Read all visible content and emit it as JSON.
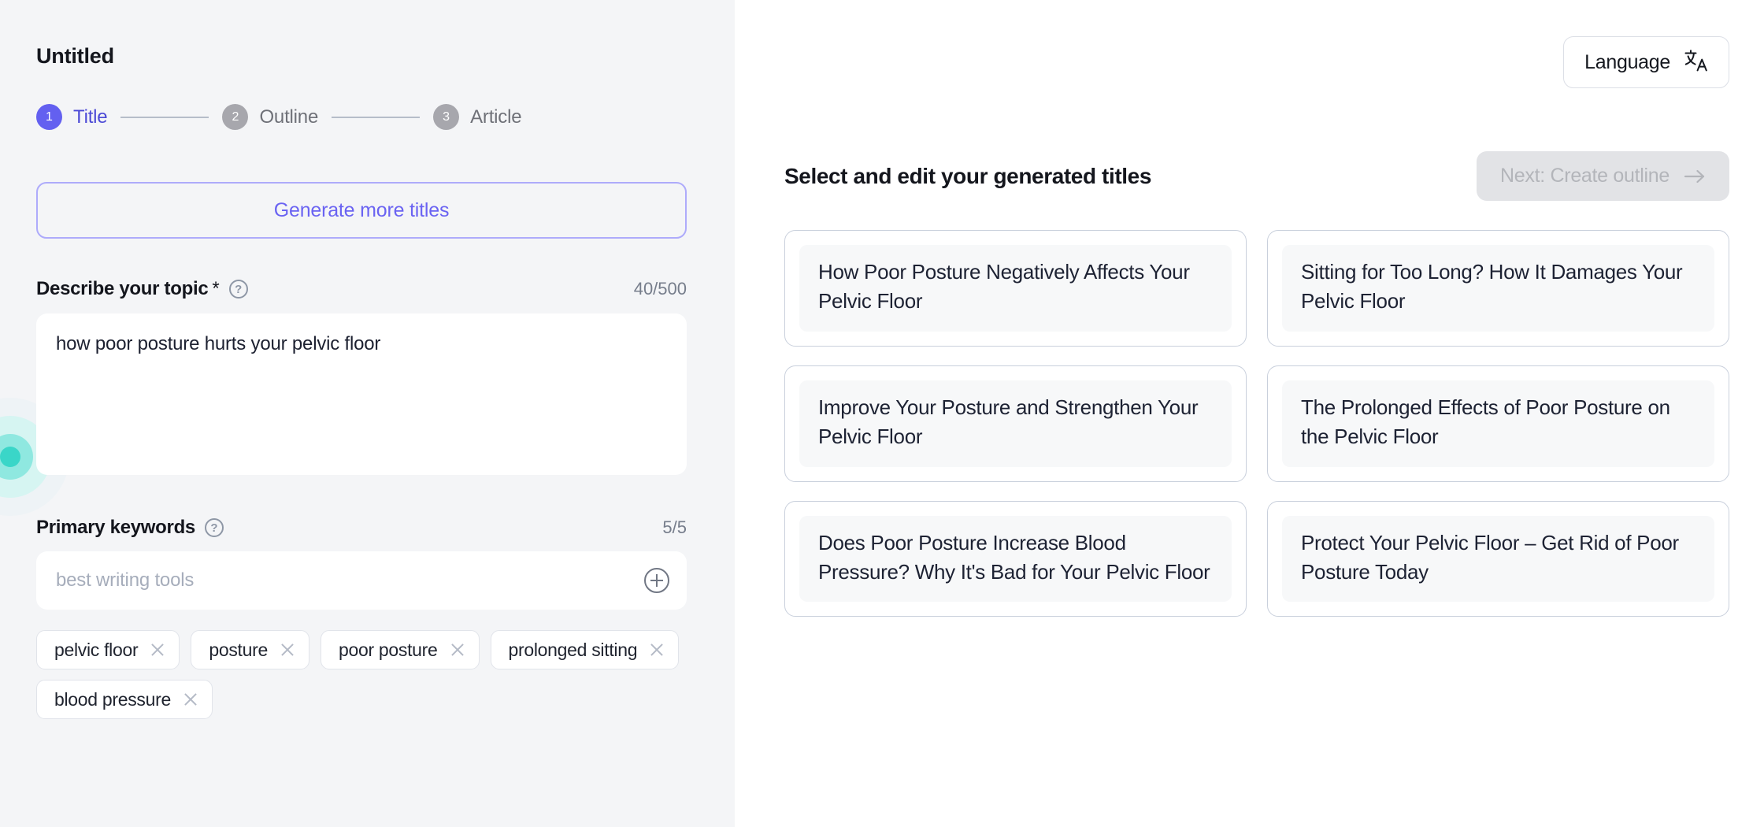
{
  "sidebar": {
    "doc_title": "Untitled",
    "steps": [
      {
        "number": "1",
        "label": "Title",
        "state": "active"
      },
      {
        "number": "2",
        "label": "Outline",
        "state": "idle"
      },
      {
        "number": "3",
        "label": "Article",
        "state": "idle"
      }
    ],
    "generate_button": "Generate more titles",
    "topic": {
      "label": "Describe your topic",
      "required_mark": "*",
      "help_icon": "help-circle-icon",
      "counter": "40/500",
      "value": "how poor posture hurts your pelvic floor",
      "placeholder": "Describe your topic"
    },
    "keywords": {
      "label": "Primary keywords",
      "help_icon": "help-circle-icon",
      "counter": "5/5",
      "input_value": "",
      "placeholder": "best writing tools",
      "add_icon": "plus-circle-icon",
      "chips": [
        "pelvic floor",
        "posture",
        "poor posture",
        "prolonged sitting",
        "blood pressure"
      ]
    }
  },
  "main": {
    "language_button": {
      "label": "Language",
      "icon": "translate-icon",
      "glyph": "文"
    },
    "heading": "Select and edit your generated titles",
    "next_button": {
      "label": "Next: Create outline",
      "icon": "arrow-right-icon",
      "disabled": "true"
    },
    "titles": [
      "How Poor Posture Negatively Affects Your Pelvic Floor",
      "Sitting for Too Long? How It Damages Your Pelvic Floor",
      "Improve Your Posture and Strengthen Your Pelvic Floor",
      "The Prolonged Effects of Poor Posture on the Pelvic Floor",
      "Does Poor Posture Increase Blood Pressure? Why It's Bad for Your Pelvic Floor",
      "Protect Your Pelvic Floor – Get Rid of Poor Posture Today"
    ]
  },
  "colors": {
    "accent_purple": "#6360f0",
    "accent_purple_text": "#4b49d6",
    "generate_border": "#aeabfb",
    "sidebar_bg": "#f4f5f7",
    "card_border": "#c9d0dc",
    "card_inner_bg": "#f7f8f9",
    "disabled_btn_bg": "#e2e3e6",
    "deco_teal": "#3ad6c8"
  }
}
